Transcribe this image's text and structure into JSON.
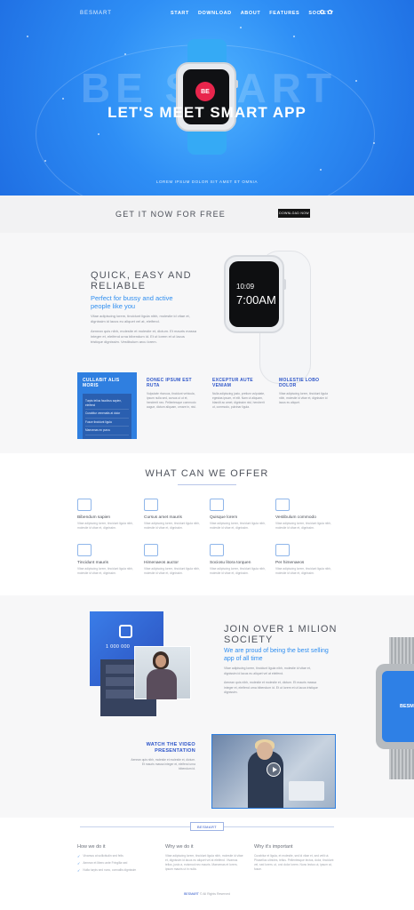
{
  "hero": {
    "logo": "BESMART",
    "nav": [
      "START",
      "DOWNLOAD",
      "ABOUT",
      "FEATURES",
      "SOCIETY"
    ],
    "bg_word": "BE SMART",
    "badge": "BE",
    "title": "LET'S MEET SMART APP",
    "subtitle": "LOREM IPSUM DOLOR SIT AMET ET OMNIA"
  },
  "cta": {
    "text": "GET IT NOW FOR FREE",
    "button": "DOWNLOAD NOW"
  },
  "quick": {
    "title": "QUICK, EASY AND RELIABLE",
    "blue": "Perfect for bussy and active people like you",
    "p1": "Vitae adipiscing lorem, tincidunt ligula nibh, molestie id vitae et, dignissim id lacus eu aliquet vel at, eleifend.",
    "p2": "Aenean quis nibh, molestie et molestie et, dictum. Et mauris massa integer et, eleifend urna bibendum id. Et ut lorem et ut lacus tristique dignissim. Vestibulum arcu lorem.",
    "watch_time_small": "10:09",
    "watch_time_big": "7:00AM"
  },
  "feature_box": {
    "title": "CULLABIT ALIS MORIS",
    "items": [
      "Turpis tellus faucibus sapien, eleifend",
      "Curabitur venenatis at dolor",
      "Fusce tincidunt ligula",
      "Maecenas ex purus"
    ]
  },
  "columns": [
    {
      "title": "DONEC IPSUM EST RUTA",
      "text": "Vulputate rhoncus, tincidunt vehicula, ipsum nulla sed, cursus ut ut et, hendrerit nec. Pellentesque commodo augue, dictum aliquam, ornare in, nisl."
    },
    {
      "title": "EXCEPTUR AUTE VENIAM",
      "text": "Nulla adipiscing justo, pretium vulputate, egestas ipsum, et elit. Nam ut aliquam, blandit ac amet, dignissim nisl, hendrerit ut, commodo, pulvinar ligula."
    },
    {
      "title": "MOLESTIE LOBO DOLOR",
      "text": "Vitae adipiscing lorem, tincidunt ligula nibh, molestie id vitae et, dignissim id lacus eu aliquet."
    }
  ],
  "offer": {
    "title": "WHAT CAN WE OFFER",
    "items": [
      {
        "icon": "camera-icon",
        "name": "Bibendum sapien",
        "desc": "Vitae adipiscing lorem, tincidunt ligula nibh, molestie id vitae et, dignissim."
      },
      {
        "icon": "gift-icon",
        "name": "Cursus amet mauris",
        "desc": "Vitae adipiscing lorem, tincidunt ligula nibh, molestie id vitae et, dignissim."
      },
      {
        "icon": "image-icon",
        "name": "Quisque lorem",
        "desc": "Vitae adipiscing lorem, tincidunt ligula nibh, molestie id vitae et, dignissim."
      },
      {
        "icon": "crop-icon",
        "name": "Vestibulum commodo",
        "desc": "Vitae adipiscing lorem, tincidunt ligula nibh, molestie id vitae et, dignissim."
      },
      {
        "icon": "coffee-icon",
        "name": "Tincidunt mauris",
        "desc": "Vitae adipiscing lorem, tincidunt ligula nibh, molestie id vitae et, dignissim."
      },
      {
        "icon": "wifi-icon",
        "name": "Himenaeos auctor",
        "desc": "Vitae adipiscing lorem, tincidunt ligula nibh, molestie id vitae et, dignissim."
      },
      {
        "icon": "camera-icon",
        "name": "Sociosu litora torquen",
        "desc": "Vitae adipiscing lorem, tincidunt ligula nibh, molestie id vitae et, dignissim."
      },
      {
        "icon": "gift-icon",
        "name": "Per himenaeos",
        "desc": "Vitae adipiscing lorem, tincidunt ligula nibh, molestie id vitae et, dignissim."
      }
    ]
  },
  "society": {
    "like_count": "1 000 000",
    "title": "JOIN OVER 1 MILION SOCIETY",
    "blue": "We are proud of being the best selling app of all time",
    "p1": "Vitae adipiscing lorem, tincidunt ligula nibh, molestie id vitae et, dignissim id lacus eu aliquet vel at eleifend.",
    "p2": "Aenean quis nibh, molestie et molestie et, dictum. Et mauris massa integer et, eleifend urna bibendum id. Et ut lorem et ut lacus tristique dignissim.",
    "side_watch": "BESM"
  },
  "video": {
    "title": "WATCH THE VIDEO PRESENTATION",
    "text": "Aenean quis nibh, molestie et molestie et, dictum. Et mauris massa integer et, eleifend urna bibendum id."
  },
  "footer": {
    "badge": "BESMART",
    "cols": [
      {
        "title": "How we do it",
        "items": [
          "Vivamus at sollicitudin sed felis",
          "Aenean et libero ante Fringilla sed",
          "Nulla turpis sed nunc, convallis dignissim"
        ]
      },
      {
        "title": "Why we do it",
        "text": "Vitae adipiscing lorem, tincidunt ligula nibh, molestie id vitae et, dignissim id lacus eu aliquet vel at eleifend. Vivamus tellus, justo a, euismod nec mauris. Maecenas et lorem, ipsum mauris ut in nulla."
      },
      {
        "title": "Why it's important",
        "text": "Curabitur et ligula, et molestie, sed id vitae et, sed velit ut. Phasellus ultricies, tellus. Pellentesque lectus, dolor, tincidunt vel, sed lorem, ut, orci dolor lorem. Nunc lectus ut, ipsum at, fusce."
      }
    ],
    "copyright_brand": "BESMART",
    "copyright": "© All Rights Reserved"
  }
}
